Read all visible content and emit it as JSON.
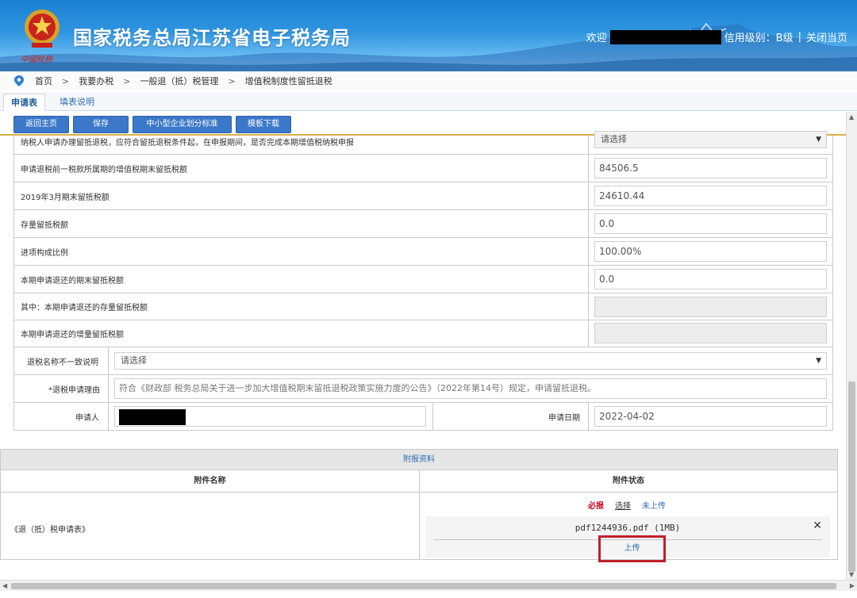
{
  "header": {
    "title": "国家税务总局江苏省电子税务局",
    "slogan": "中國稅務",
    "welcome": "欢迎",
    "credit_level": "信用级别：B级",
    "close_page": "关闭当页"
  },
  "breadcrumb": [
    "首页",
    "我要办税",
    "一般退（抵）税管理",
    "增值税制度性留抵退税"
  ],
  "tabs": [
    "申请表",
    "填表说明"
  ],
  "toolbar": {
    "back": "返回主页",
    "save": "保存",
    "sme_standard": "中小型企业划分标准",
    "template_download": "模板下载"
  },
  "form": {
    "rows": [
      {
        "label": "纳税人申请办理留抵退税，应符合留抵退税条件起，在申报期间，是否完成本期增值税纳税申报",
        "value": "请选择"
      },
      {
        "label": "申请退税前一税款所属期的增值税期末留抵税额",
        "value": "84506.5"
      },
      {
        "label": "2019年3月期末留抵税额",
        "value": "24610.44"
      },
      {
        "label": "存量留抵税额",
        "value": "0.0"
      },
      {
        "label": "进项构成比例",
        "value": "100.00%"
      },
      {
        "label": "本期申请退还的期末留抵税额",
        "value": "0.0"
      },
      {
        "label": "其中：本期申请退还的存量留抵税额",
        "value": ""
      },
      {
        "label": "本期申请退还的增量留抵税额",
        "value": ""
      }
    ],
    "name_mismatch_label": "退税名称不一致说明",
    "name_mismatch_value": "请选择",
    "reason_label": "*退税申请理由",
    "reason_value": "符合《财政部 税务总局关于进一步加大增值税期末留抵退税政策实施力度的公告》（2022年第14号）规定，申请留抵退税。",
    "applicant_label": "申请人",
    "date_label": "申请日期",
    "date_value": "2022-04-02"
  },
  "attachments": {
    "title": "附报资料",
    "col_name": "附件名称",
    "col_status": "附件状态",
    "row_name": "《退（抵）税申请表》",
    "required": "必报",
    "choose": "选择",
    "not_uploaded": "未上传",
    "filename": "pdf1244936.pdf (1MB)",
    "upload": "上传"
  },
  "colors": {
    "header_blue": "#2f95e0",
    "button_blue": "#3b78c9",
    "required_red": "#d0021b",
    "highlight_red": "#c0202a"
  }
}
